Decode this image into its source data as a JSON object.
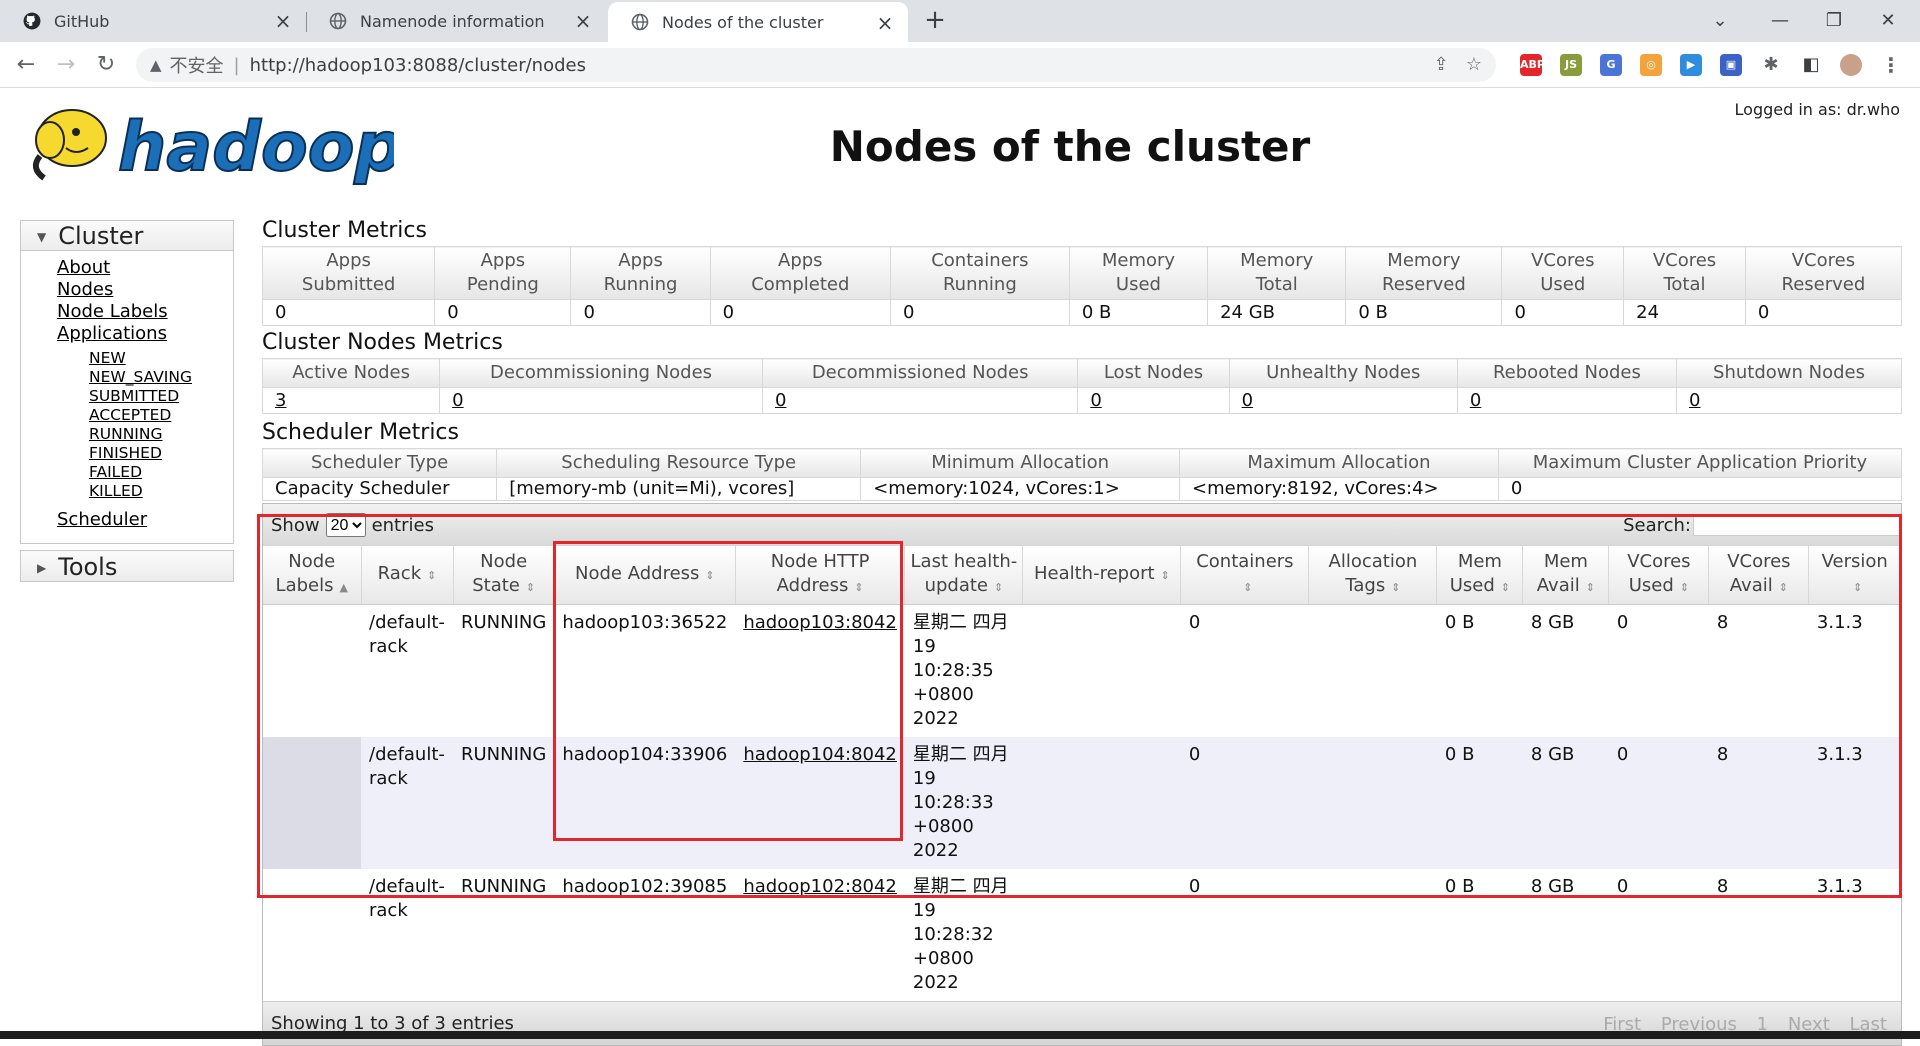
{
  "browser": {
    "tabs": [
      {
        "title": "GitHub",
        "icon": "github-icon"
      },
      {
        "title": "Namenode information",
        "icon": "globe-icon"
      },
      {
        "title": "Nodes of the cluster",
        "icon": "globe-icon",
        "active": true
      }
    ],
    "address": {
      "insecure_label": "不安全",
      "url": "http://hadoop103:8088/cluster/nodes"
    }
  },
  "header": {
    "logo_text": "hadoop",
    "logged_in": "Logged in as: dr.who",
    "title": "Nodes of the cluster"
  },
  "sidebar": {
    "cluster_label": "Cluster",
    "links": [
      "About",
      "Nodes",
      "Node Labels",
      "Applications"
    ],
    "app_states": [
      "NEW",
      "NEW_SAVING",
      "SUBMITTED",
      "ACCEPTED",
      "RUNNING",
      "FINISHED",
      "FAILED",
      "KILLED"
    ],
    "scheduler": "Scheduler",
    "tools_label": "Tools"
  },
  "cluster_metrics": {
    "title": "Cluster Metrics",
    "headers": [
      [
        "Apps",
        "Submitted"
      ],
      [
        "Apps",
        "Pending"
      ],
      [
        "Apps",
        "Running"
      ],
      [
        "Apps",
        "Completed"
      ],
      [
        "Containers",
        "Running"
      ],
      [
        "Memory",
        "Used"
      ],
      [
        "Memory",
        "Total"
      ],
      [
        "Memory",
        "Reserved"
      ],
      [
        "VCores",
        "Used"
      ],
      [
        "VCores",
        "Total"
      ],
      [
        "VCores",
        "Reserved"
      ]
    ],
    "values": [
      "0",
      "0",
      "0",
      "0",
      "0",
      "0 B",
      "24 GB",
      "0 B",
      "0",
      "24",
      "0"
    ]
  },
  "nodes_metrics": {
    "title": "Cluster Nodes Metrics",
    "headers": [
      "Active Nodes",
      "Decommissioning Nodes",
      "Decommissioned Nodes",
      "Lost Nodes",
      "Unhealthy Nodes",
      "Rebooted Nodes",
      "Shutdown Nodes"
    ],
    "values": [
      "3",
      "0",
      "0",
      "0",
      "0",
      "0",
      "0"
    ]
  },
  "scheduler_metrics": {
    "title": "Scheduler Metrics",
    "headers": [
      "Scheduler Type",
      "Scheduling Resource Type",
      "Minimum Allocation",
      "Maximum Allocation",
      "Maximum Cluster Application Priority"
    ],
    "values": [
      "Capacity Scheduler",
      "[memory-mb (unit=Mi), vcores]",
      "<memory:1024, vCores:1>",
      "<memory:8192, vCores:4>",
      "0"
    ]
  },
  "nodes_table": {
    "show_label": "Show",
    "page_size": "20",
    "entries_label": "entries",
    "search_label": "Search:",
    "headers": [
      [
        "Node",
        "Labels"
      ],
      [
        "Rack",
        ""
      ],
      [
        "Node",
        "State"
      ],
      [
        "Node Address",
        ""
      ],
      [
        "Node HTTP",
        "Address"
      ],
      [
        "Last health-",
        "update"
      ],
      [
        "Health-report",
        ""
      ],
      [
        "Containers",
        ""
      ],
      [
        "Allocation",
        "Tags"
      ],
      [
        "Mem",
        "Used"
      ],
      [
        "Mem",
        "Avail"
      ],
      [
        "VCores",
        "Used"
      ],
      [
        "VCores",
        "Avail"
      ],
      [
        "Version",
        ""
      ]
    ],
    "rows": [
      {
        "labels": "",
        "rack": "/default-rack",
        "state": "RUNNING",
        "address": "hadoop103:36522",
        "http": "hadoop103:8042",
        "health_update": "星期二 四月 19 10:28:35 +0800 2022",
        "health_report": "",
        "containers": "0",
        "tags": "",
        "mem_used": "0 B",
        "mem_avail": "8 GB",
        "vcores_used": "0",
        "vcores_avail": "8",
        "version": "3.1.3"
      },
      {
        "labels": "",
        "rack": "/default-rack",
        "state": "RUNNING",
        "address": "hadoop104:33906",
        "http": "hadoop104:8042",
        "health_update": "星期二 四月 19 10:28:33 +0800 2022",
        "health_report": "",
        "containers": "0",
        "tags": "",
        "mem_used": "0 B",
        "mem_avail": "8 GB",
        "vcores_used": "0",
        "vcores_avail": "8",
        "version": "3.1.3"
      },
      {
        "labels": "",
        "rack": "/default-rack",
        "state": "RUNNING",
        "address": "hadoop102:39085",
        "http": "hadoop102:8042",
        "health_update": "星期二 四月 19 10:28:32 +0800 2022",
        "health_report": "",
        "containers": "0",
        "tags": "",
        "mem_used": "0 B",
        "mem_avail": "8 GB",
        "vcores_used": "0",
        "vcores_avail": "8",
        "version": "3.1.3"
      }
    ],
    "footer": "Showing 1 to 3 of 3 entries",
    "pager": [
      "First",
      "Previous",
      "1",
      "Next",
      "Last"
    ]
  },
  "colors": {
    "highlight": "#e3262c",
    "logo_blue": "#1a6fb8",
    "logo_yellow": "#f6d92f"
  }
}
